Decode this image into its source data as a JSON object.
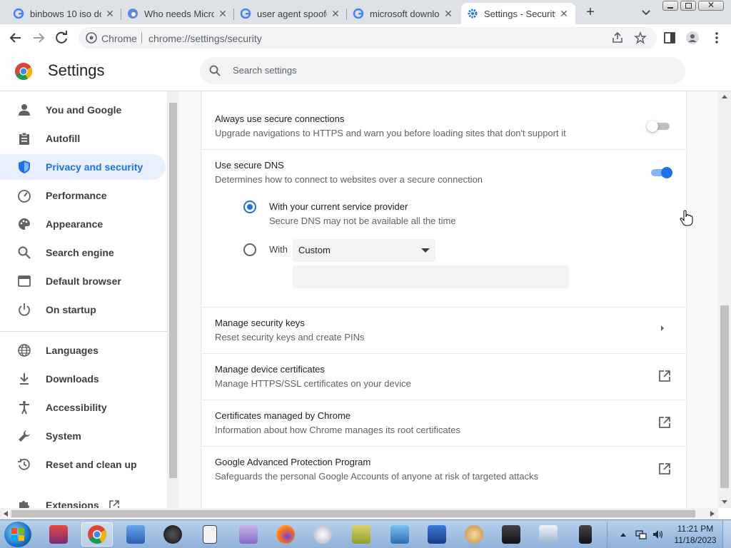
{
  "tabs": [
    {
      "title": "binbows 10 iso do",
      "favicon": "google-icon"
    },
    {
      "title": "Who needs Micro",
      "favicon": "edge-icon"
    },
    {
      "title": "user agent spoofe",
      "favicon": "google-icon"
    },
    {
      "title": "microsoft downlo",
      "favicon": "google-icon"
    },
    {
      "title": "Settings - Security",
      "favicon": "gear-icon",
      "active": true
    }
  ],
  "omnibox": {
    "site_label": "Chrome",
    "url": "chrome://settings/security"
  },
  "header": {
    "title": "Settings",
    "search_placeholder": "Search settings"
  },
  "sidebar": {
    "items": [
      {
        "label": "You and Google",
        "icon": "person-icon"
      },
      {
        "label": "Autofill",
        "icon": "clipboard-icon"
      },
      {
        "label": "Privacy and security",
        "icon": "shield-icon",
        "active": true
      },
      {
        "label": "Performance",
        "icon": "speedometer-icon"
      },
      {
        "label": "Appearance",
        "icon": "palette-icon"
      },
      {
        "label": "Search engine",
        "icon": "search-icon"
      },
      {
        "label": "Default browser",
        "icon": "browser-window-icon"
      },
      {
        "label": "On startup",
        "icon": "power-icon"
      },
      {
        "label": "Languages",
        "icon": "globe-icon"
      },
      {
        "label": "Downloads",
        "icon": "download-icon"
      },
      {
        "label": "Accessibility",
        "icon": "accessibility-icon"
      },
      {
        "label": "System",
        "icon": "wrench-icon"
      },
      {
        "label": "Reset and clean up",
        "icon": "history-icon"
      },
      {
        "label": "Extensions",
        "icon": "puzzle-icon"
      }
    ]
  },
  "security": {
    "https": {
      "title": "Always use secure connections",
      "sub": "Upgrade navigations to HTTPS and warn you before loading sites that don't support it",
      "enabled": false
    },
    "dns": {
      "title": "Use secure DNS",
      "sub": "Determines how to connect to websites over a secure connection",
      "enabled": true,
      "option_current": {
        "title": "With your current service provider",
        "sub": "Secure DNS may not be available all the time",
        "selected": true
      },
      "option_custom": {
        "label": "With",
        "select_value": "Custom",
        "selected": false,
        "input_value": ""
      }
    },
    "keys": {
      "title": "Manage security keys",
      "sub": "Reset security keys and create PINs"
    },
    "certs": {
      "title": "Manage device certificates",
      "sub": "Manage HTTPS/SSL certificates on your device"
    },
    "chrome_certs": {
      "title": "Certificates managed by Chrome",
      "sub": "Information about how Chrome manages its root certificates"
    },
    "gapp": {
      "title": "Google Advanced Protection Program",
      "sub": "Safeguards the personal Google Accounts of anyone at risk of targeted attacks"
    }
  },
  "taskbar": {
    "clock_time": "11:21 PM",
    "clock_date": "11/18/2023"
  },
  "colors": {
    "accent": "#1a73e8",
    "sidebar_active_bg": "#e8f0fe"
  }
}
